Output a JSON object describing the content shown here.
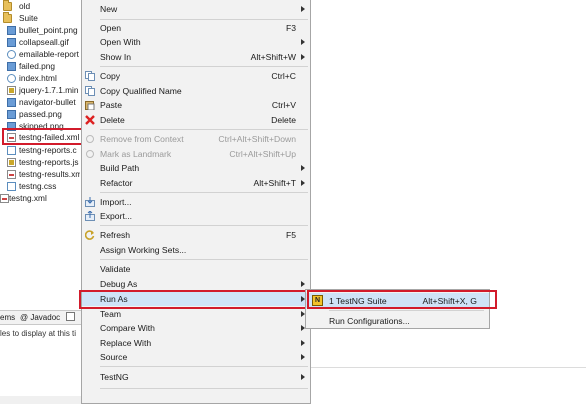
{
  "tree": {
    "items": [
      {
        "label": "old",
        "icon": "folder-icon",
        "kind": "folder"
      },
      {
        "label": "Suite",
        "icon": "folder-icon",
        "kind": "folder"
      },
      {
        "label": "bullet_point.png",
        "icon": "image-file-icon",
        "kind": "file-img"
      },
      {
        "label": "collapseall.gif",
        "icon": "image-file-icon",
        "kind": "file-img"
      },
      {
        "label": "emailable-report",
        "icon": "web-file-icon",
        "kind": "file-web"
      },
      {
        "label": "failed.png",
        "icon": "image-file-icon",
        "kind": "file-img"
      },
      {
        "label": "index.html",
        "icon": "web-file-icon",
        "kind": "file-web"
      },
      {
        "label": "jquery-1.7.1.min",
        "icon": "js-file-icon",
        "kind": "file-js"
      },
      {
        "label": "navigator-bullet",
        "icon": "image-file-icon",
        "kind": "file-img"
      },
      {
        "label": "passed.png",
        "icon": "image-file-icon",
        "kind": "file-img"
      },
      {
        "label": "skipped.png",
        "icon": "image-file-icon",
        "kind": "file-img"
      },
      {
        "label": "testng-failed.xml",
        "icon": "xml-file-icon",
        "kind": "file-xml"
      },
      {
        "label": "testng-reports.c",
        "icon": "css-file-icon",
        "kind": "file-css"
      },
      {
        "label": "testng-reports.js",
        "icon": "js-file-icon",
        "kind": "file-js"
      },
      {
        "label": "testng-results.xm",
        "icon": "xml-file-icon",
        "kind": "file-xml"
      },
      {
        "label": "testng.css",
        "icon": "css-file-icon",
        "kind": "file-css"
      },
      {
        "label": "testng.xml",
        "icon": "xml-file-icon",
        "kind": "file-xml"
      }
    ]
  },
  "bottom": {
    "tab_items": "ems",
    "tab_javadoc": "@ Javadoc",
    "message": "les to display at this ti"
  },
  "menu": {
    "items": [
      {
        "label": "New",
        "shortcut": "",
        "submenu": true
      },
      {
        "label": "Open",
        "shortcut": "F3"
      },
      {
        "label": "Open With",
        "shortcut": "",
        "submenu": true
      },
      {
        "label": "Show In",
        "shortcut": "Alt+Shift+W",
        "submenu": true
      },
      {
        "label": "Copy",
        "shortcut": "Ctrl+C",
        "icon": "copy-icon"
      },
      {
        "label": "Copy Qualified Name",
        "shortcut": "",
        "icon": "copy-icon"
      },
      {
        "label": "Paste",
        "shortcut": "Ctrl+V",
        "icon": "paste-icon"
      },
      {
        "label": "Delete",
        "shortcut": "Delete",
        "icon": "delete-icon"
      },
      {
        "label": "Remove from Context",
        "shortcut": "Ctrl+Alt+Shift+Down",
        "disabled": true
      },
      {
        "label": "Mark as Landmark",
        "shortcut": "Ctrl+Alt+Shift+Up",
        "disabled": true
      },
      {
        "label": "Build Path",
        "shortcut": "",
        "submenu": true
      },
      {
        "label": "Refactor",
        "shortcut": "Alt+Shift+T",
        "submenu": true
      },
      {
        "label": "Import...",
        "shortcut": "",
        "icon": "import-icon"
      },
      {
        "label": "Export...",
        "shortcut": "",
        "icon": "export-icon"
      },
      {
        "label": "Refresh",
        "shortcut": "F5",
        "icon": "refresh-icon"
      },
      {
        "label": "Assign Working Sets...",
        "shortcut": ""
      },
      {
        "label": "Validate",
        "shortcut": ""
      },
      {
        "label": "Debug As",
        "shortcut": "",
        "submenu": true
      },
      {
        "label": "Run As",
        "shortcut": "",
        "submenu": true
      },
      {
        "label": "Team",
        "shortcut": "",
        "submenu": true
      },
      {
        "label": "Compare With",
        "shortcut": "",
        "submenu": true
      },
      {
        "label": "Replace With",
        "shortcut": "",
        "submenu": true
      },
      {
        "label": "Source",
        "shortcut": "",
        "submenu": true
      },
      {
        "label": "TestNG",
        "shortcut": "",
        "submenu": true
      }
    ]
  },
  "submenu": {
    "items": [
      {
        "label": "1 TestNG Suite",
        "shortcut": "Alt+Shift+X, G",
        "icon_text": "N"
      },
      {
        "label": "Run Configurations...",
        "shortcut": ""
      }
    ]
  },
  "colors": {
    "highlight_box": "#d21b2b",
    "hover": "#cfe3f7",
    "menu_bg": "#f2f2f2"
  }
}
